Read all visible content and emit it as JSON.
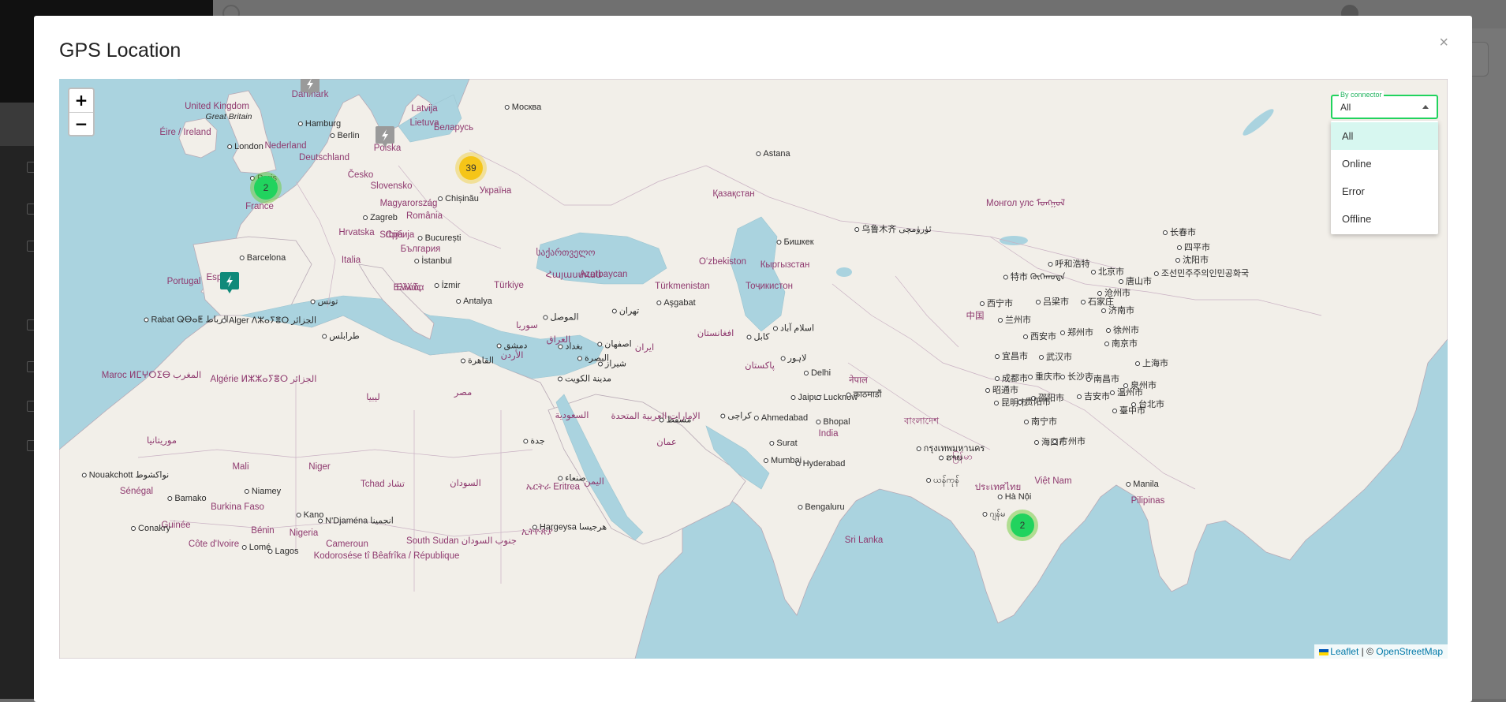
{
  "modal": {
    "title": "GPS Location",
    "close_symbol": "×"
  },
  "zoom": {
    "in": "+",
    "out": "−"
  },
  "filter": {
    "label": "By connector",
    "value": "All",
    "options": [
      "All",
      "Online",
      "Error",
      "Offline"
    ]
  },
  "clusters": [
    {
      "count": "2",
      "color": "#21d35e"
    },
    {
      "count": "39",
      "color": "#f5c518"
    },
    {
      "count": "2",
      "color": "#21d35e"
    }
  ],
  "markers": [
    {
      "icon": "bolt-icon",
      "color": "#9a9a9a"
    },
    {
      "icon": "bolt-icon",
      "color": "#9a9a9a"
    },
    {
      "icon": "bolt-icon",
      "color": "#0f8a7a"
    }
  ],
  "attribution": {
    "leaflet": "Leaflet",
    "separator": " | © ",
    "osm": "OpenStreetMap"
  },
  "map_labels": {
    "countries": [
      "Danmark",
      "Latvija",
      "United Kingdom",
      "Lietuva",
      "Éire / Ireland",
      "Polska",
      "Беларусь",
      "Nederland",
      "Deutschland",
      "Česko",
      "Slovensko",
      "Україна",
      "France",
      "Magyarország",
      "Hrvatska",
      "România",
      "Србија",
      "България",
      "Italia",
      "Portugal",
      "España",
      "Ελλάς",
      "Türkiye",
      "საქართველო",
      "Azərbaycan",
      "Қазақстан",
      "Oʻzbekiston",
      "Кыргызстан",
      "Türkmenistan",
      "Тоҷикистон",
      "Монгол улс ᠮᠤᠩᠭᠣᠯ",
      "中国",
      "Maroc ⵍⵎⵖⵔⵉⴱ المغرب",
      "Algérie ⵍⵣⵣⴰⵢⴻⵔ الجزائر",
      "ليبيا",
      "مصر",
      "السعودية",
      "العراق",
      "ایران",
      "افغانستان",
      "پاکستان",
      "الإمارات العربية المتحدة",
      "عمان",
      "India",
      "नेपाल",
      "বাংলাদেশ",
      "မြန်မာ",
      "ประเทศไทย",
      "Việt Nam",
      "Pilipinas",
      "موريتانيا",
      "Mali",
      "Niger",
      "Tchad تشاد",
      "السودان",
      "ኢትዮጵያ",
      "ኤርትራ Eritrea",
      "اليمن",
      "Sénégal",
      "Burkina Faso",
      "Guinée",
      "Bénin",
      "Nigeria",
      "Cameroun",
      "South Sudan جنوب السودان",
      "Kodorosése tî Bêafrîka / République",
      "Côte d'Ivoire",
      "Sri Lanka",
      "Srbija",
      "سوريا",
      "الأردن",
      "Հայաստան",
      "Ελλάδα"
    ],
    "cities": [
      "Москва",
      "Hamburg",
      "Berlin",
      "London",
      "Great Britain",
      "Paris",
      "Chișinău",
      "Zagreb",
      "București",
      "Barcelona",
      "İstanbul",
      "İzmir",
      "Antalya",
      "Rabat ⵕⴱⴰⵟ الرباط",
      "Alger ⴷⵣⴰⵢⴻⵔ الجزائر",
      "تونس",
      "طرابلس",
      "القاهرة",
      "دمشق",
      "الموصل",
      "بغداد",
      "تهران",
      "اصفهان",
      "شیراز",
      "البصرة",
      "مدينة الكويت",
      "جدة",
      "صنعاء",
      "مسقط",
      "كراچی",
      "Aşgabat",
      "Astana",
      "Бишкек",
      "乌鲁木齐 ئۈرۈمچى",
      "كابل",
      "اسلام آباد",
      "لاہور",
      "Delhi",
      "Jaipur",
      "Lucknow",
      "काठमाडौं",
      "Ahmedabad",
      "Bhopal",
      "Surat",
      "Mumbai",
      "Hyderabad",
      "Bengaluru",
      "Nouakchott نواكشوط",
      "Bamako",
      "Niamey",
      "Kano",
      "N'Djaména انجمينا",
      "Conakry",
      "Lomé",
      "Lagos",
      "Hargeysa هرجيسا",
      "西宁市",
      "兰州市",
      "呼和浩特",
      "北京市",
      "特市 ᠬᠥᠬᠡᠬᠣᠲᠠ",
      "石家庄",
      "沧州市",
      "唐山市",
      "济南市",
      "吕梁市",
      "西安市",
      "郑州市",
      "徐州市",
      "南京市",
      "上海市",
      "武汉市",
      "宜昌市",
      "成都市",
      "重庆市",
      "长沙市",
      "南昌市",
      "温州市",
      "吉安市",
      "邵阳市",
      "台北市",
      "臺中市",
      "泉州市",
      "昆明市",
      "贵阳市",
      "昭通市",
      "南宁市",
      "广州市",
      "海口市",
      "Hà Nội",
      "Manila",
      "长春市",
      "四平市",
      "沈阳市",
      "조선민주주의인민공화국",
      "ຮາຍ",
      "ယန်ကုန်",
      "ဂျန်မ",
      "กรุงเทพมหานคร"
    ]
  }
}
